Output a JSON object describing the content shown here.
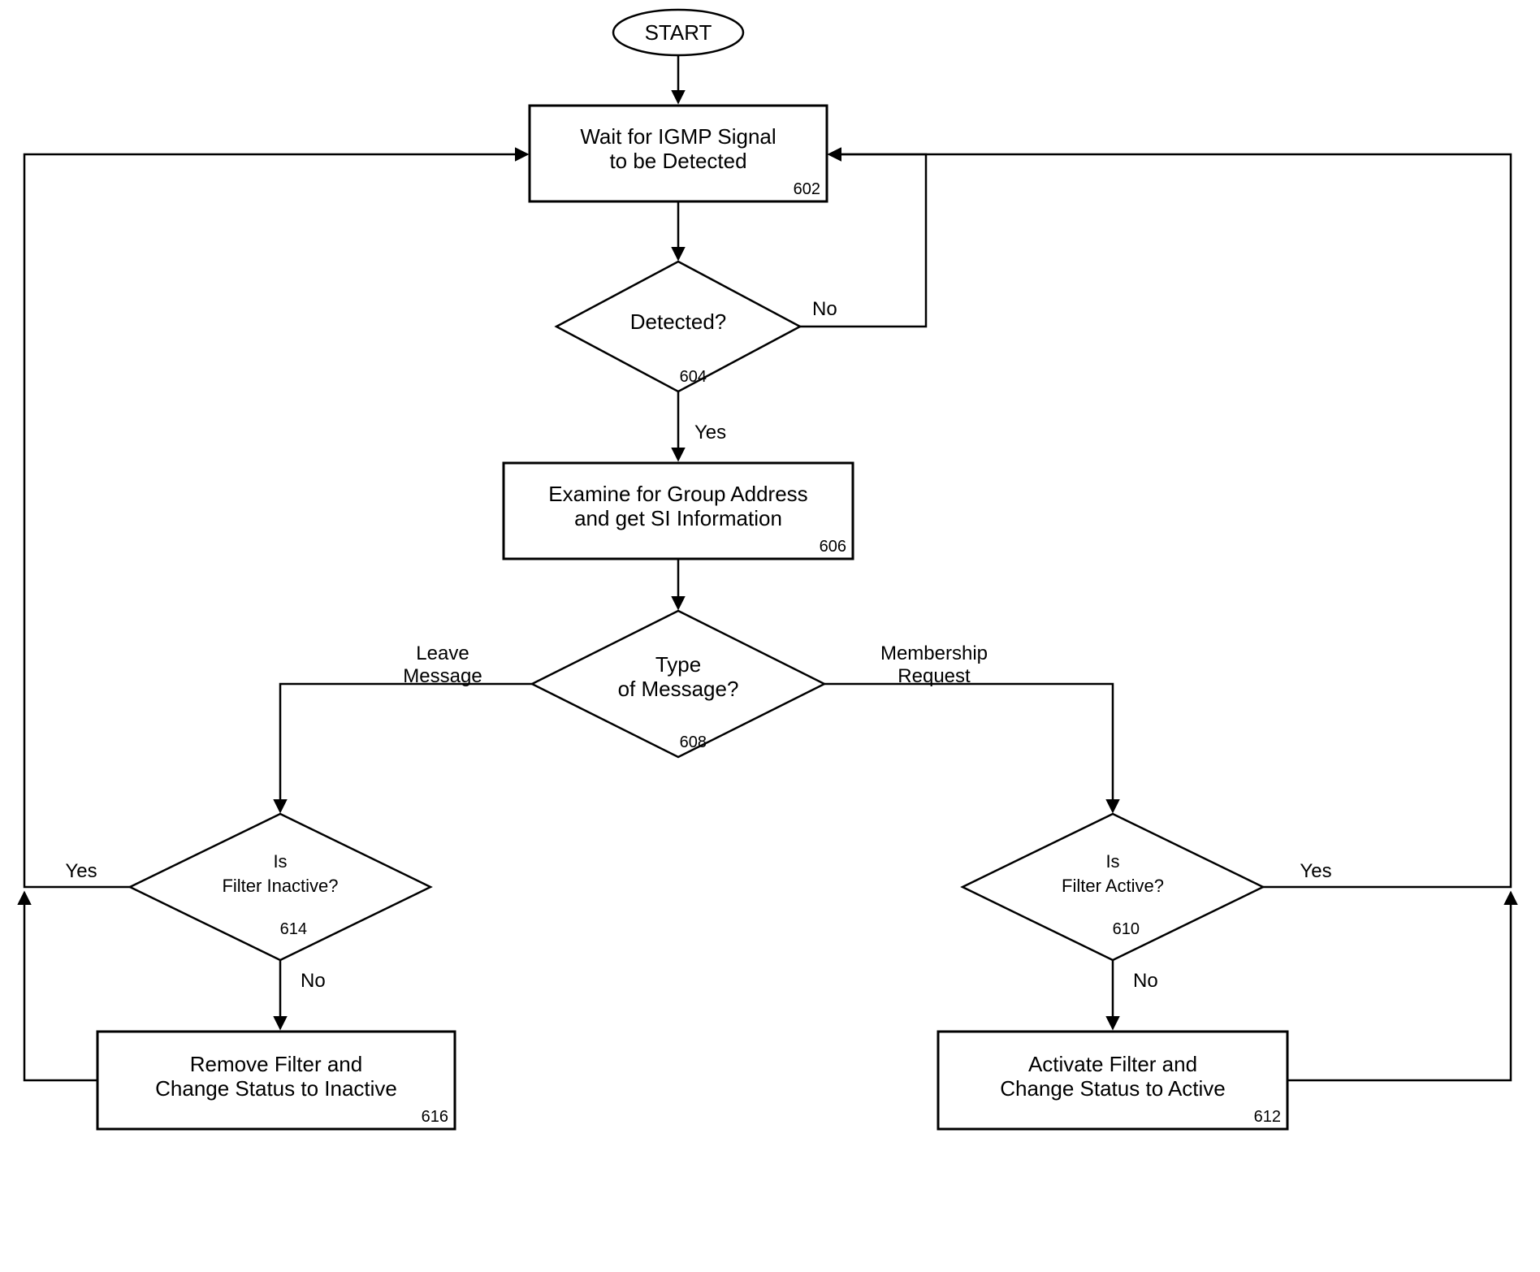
{
  "terminator": {
    "start": "START"
  },
  "nodes": {
    "n602": {
      "line1": "Wait for IGMP Signal",
      "line2": "to be Detected",
      "ref": "602"
    },
    "n604": {
      "line1": "Detected?",
      "ref": "604"
    },
    "n606": {
      "line1": "Examine for Group Address",
      "line2": "and get SI Information",
      "ref": "606"
    },
    "n608": {
      "line1": "Type",
      "line2": "of Message?",
      "ref": "608"
    },
    "n610": {
      "line1": "Is",
      "line2": "Filter Active?",
      "ref": "610"
    },
    "n612": {
      "line1": "Activate Filter and",
      "line2": "Change Status to Active",
      "ref": "612"
    },
    "n614": {
      "line1": "Is",
      "line2": "Filter Inactive?",
      "ref": "614"
    },
    "n616": {
      "line1": "Remove Filter and",
      "line2": "Change Status to Inactive",
      "ref": "616"
    }
  },
  "edges": {
    "yes": "Yes",
    "no": "No",
    "leave1": "Leave",
    "leave2": "Message",
    "member1": "Membership",
    "member2": "Request"
  }
}
